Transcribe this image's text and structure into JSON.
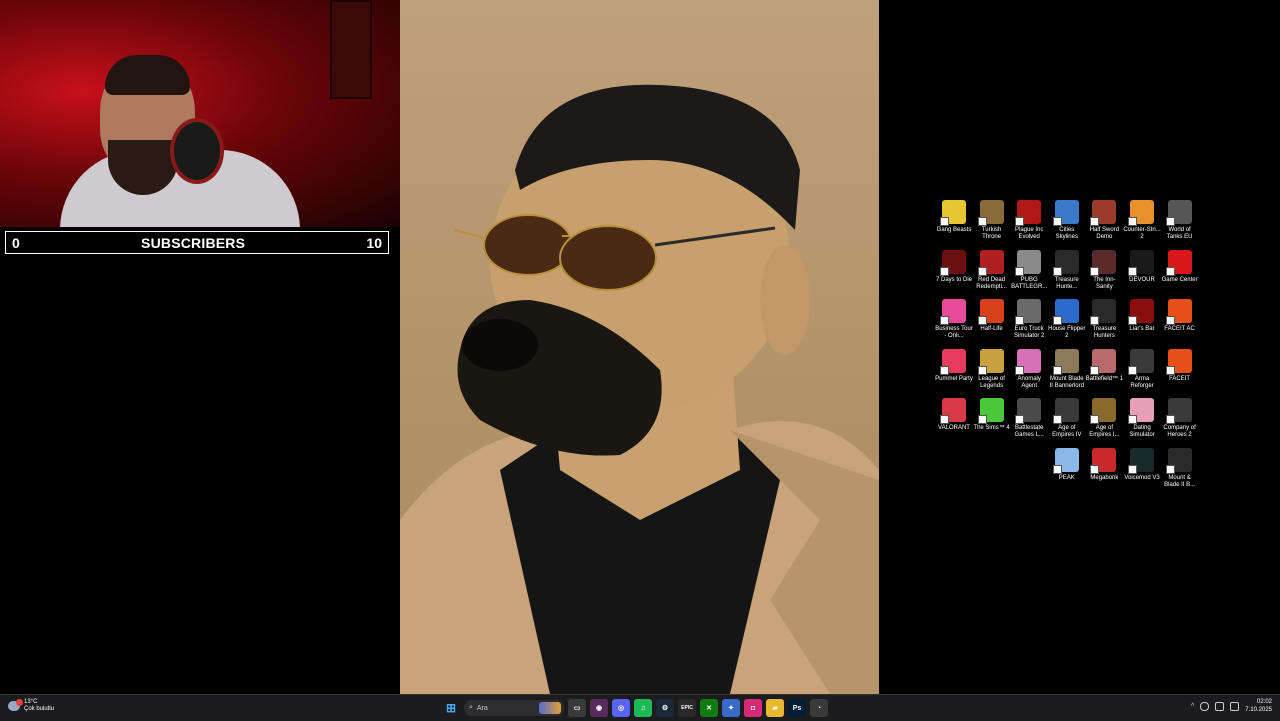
{
  "overlay": {
    "subscribers": {
      "current": "0",
      "label": "SUBSCRIBERS",
      "goal": "10"
    }
  },
  "desktop": {
    "icons": [
      {
        "label": "Gang Beasts",
        "color": "#e8c830",
        "icon": "gang-beasts-icon"
      },
      {
        "label": "Turkish Throne",
        "color": "#8a6a3a",
        "icon": "turkish-throne-icon"
      },
      {
        "label": "Plague Inc Evolved",
        "color": "#b01818",
        "icon": "plague-inc-icon"
      },
      {
        "label": "Cities Skylines",
        "color": "#3a7ac8",
        "icon": "cities-skylines-icon"
      },
      {
        "label": "Half Sword Demo",
        "color": "#9a3a2a",
        "icon": "half-sword-icon"
      },
      {
        "label": "Counter-Stri... 2",
        "color": "#e8902a",
        "icon": "counter-strike-icon"
      },
      {
        "label": "World of Tanks EU",
        "color": "#555555",
        "icon": "world-of-tanks-icon"
      },
      {
        "label": "7 Days to Die",
        "color": "#6a1010",
        "icon": "7-days-to-die-icon"
      },
      {
        "label": "Red Dead Redempti...",
        "color": "#b02020",
        "icon": "red-dead-icon"
      },
      {
        "label": "PUBG BATTLEGR...",
        "color": "#8a8a8a",
        "icon": "pubg-icon"
      },
      {
        "label": "Treasure Hunte...",
        "color": "#2a2a2a",
        "icon": "treasure-hunter-icon"
      },
      {
        "label": "The Inn-Sanity",
        "color": "#5a2a2a",
        "icon": "inn-sanity-icon"
      },
      {
        "label": "DEVOUR",
        "color": "#1a1a1a",
        "icon": "devour-icon"
      },
      {
        "label": "Game Center",
        "color": "#d81818",
        "icon": "game-center-icon"
      },
      {
        "label": "Business Tour - Onli...",
        "color": "#e84a9a",
        "icon": "business-tour-icon"
      },
      {
        "label": "Half-Life",
        "color": "#d8401a",
        "icon": "half-life-icon"
      },
      {
        "label": "Euro Truck Simulator 2",
        "color": "#6a6a6a",
        "icon": "euro-truck-icon"
      },
      {
        "label": "House Flipper 2",
        "color": "#2a6ac8",
        "icon": "house-flipper-icon"
      },
      {
        "label": "Treasure Hunters",
        "color": "#2a2a2a",
        "icon": "treasure-hunters-icon"
      },
      {
        "label": "Liar's Bar",
        "color": "#8a1010",
        "icon": "liars-bar-icon"
      },
      {
        "label": "FACEIT AC",
        "color": "#e8501a",
        "icon": "faceit-ac-icon"
      },
      {
        "label": "Pummel Party",
        "color": "#e83a5a",
        "icon": "pummel-party-icon"
      },
      {
        "label": "League of Legends",
        "color": "#c8a040",
        "icon": "league-of-legends-icon"
      },
      {
        "label": "Anomaly Agent",
        "color": "#d870b8",
        "icon": "anomaly-agent-icon"
      },
      {
        "label": "Mount Blade II Bannerlord",
        "color": "#8a7a5a",
        "icon": "bannerlord-icon"
      },
      {
        "label": "Battlefield™ 1",
        "color": "#b86a6a",
        "icon": "battlefield-icon"
      },
      {
        "label": "Arma Reforger",
        "color": "#3a3a3a",
        "icon": "arma-reforger-icon"
      },
      {
        "label": "FACEIT",
        "color": "#e8501a",
        "icon": "faceit-icon"
      },
      {
        "label": "VALORANT",
        "color": "#d83a4a",
        "icon": "valorant-icon"
      },
      {
        "label": "The Sims™ 4",
        "color": "#4ac83a",
        "icon": "sims-icon"
      },
      {
        "label": "Battlestate Games L...",
        "color": "#4a4a4a",
        "icon": "battlestate-icon"
      },
      {
        "label": "Age of Empires IV",
        "color": "#3a3a3a",
        "icon": "age-of-empires-iv-icon"
      },
      {
        "label": "Age of Empires I...",
        "color": "#8a6a2a",
        "icon": "age-of-empires-icon"
      },
      {
        "label": "Dating Simulator",
        "color": "#e8a0b8",
        "icon": "dating-simulator-icon"
      },
      {
        "label": "Company of Heroes 2",
        "color": "#3a3a3a",
        "icon": "company-of-heroes-icon"
      },
      {
        "label": "PEAK",
        "color": "#8ab8e8",
        "icon": "peak-icon"
      },
      {
        "label": "Megabonk",
        "color": "#c82a2a",
        "icon": "megabonk-icon"
      },
      {
        "label": "Voicemod V3",
        "color": "#1a2a2a",
        "icon": "voicemod-icon"
      },
      {
        "label": "Mount & Blade II B...",
        "color": "#2a2a2a",
        "icon": "mount-blade-icon"
      }
    ]
  },
  "taskbar": {
    "weather": {
      "temp": "13°C",
      "desc": "Çok bulutlu"
    },
    "search": {
      "placeholder": "Ara"
    },
    "apps": [
      {
        "name": "file-explorer-icon",
        "color": "#3a3a3a",
        "glyph": "▭"
      },
      {
        "name": "obs-icon",
        "color": "#5a2a5a",
        "glyph": "◉"
      },
      {
        "name": "discord-icon",
        "color": "#5865f2",
        "glyph": "◎"
      },
      {
        "name": "spotify-icon",
        "color": "#1db954",
        "glyph": "♫"
      },
      {
        "name": "steam-icon",
        "color": "#1b2838",
        "glyph": "⚙"
      },
      {
        "name": "epic-games-icon",
        "color": "#2a2a2a",
        "glyph": "EPIC"
      },
      {
        "name": "xbox-icon",
        "color": "#107c10",
        "glyph": "✕"
      },
      {
        "name": "copilot-icon",
        "color": "#3a6ac8",
        "glyph": "✦"
      },
      {
        "name": "instagram-icon",
        "color": "#d62976",
        "glyph": "◘"
      },
      {
        "name": "folder-icon",
        "color": "#e8b830",
        "glyph": "▰"
      },
      {
        "name": "photoshop-icon",
        "color": "#001e36",
        "glyph": "Ps"
      },
      {
        "name": "chrome-icon",
        "color": "#3a3a3a",
        "glyph": "◔"
      }
    ],
    "clock": {
      "time": "02:02",
      "date": "7.10.2025"
    }
  }
}
